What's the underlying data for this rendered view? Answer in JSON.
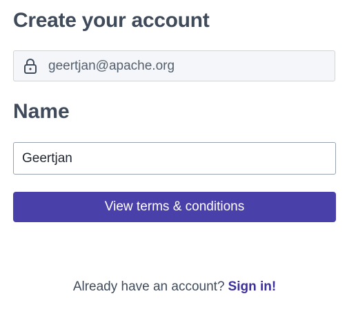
{
  "header": {
    "title": "Create your account"
  },
  "email": {
    "value": "geertjan@apache.org",
    "icon": "lock-icon",
    "locked": true
  },
  "name": {
    "label": "Name",
    "value": "Geertjan"
  },
  "terms": {
    "button_label": "View terms & conditions"
  },
  "footer": {
    "prompt": "Already have an account?",
    "signin_label": "Sign in!"
  },
  "colors": {
    "text": "#3f4a5a",
    "primary_button": "#4a40aa",
    "link": "#3b2f9c",
    "locked_field_bg": "#f4f6f9"
  }
}
